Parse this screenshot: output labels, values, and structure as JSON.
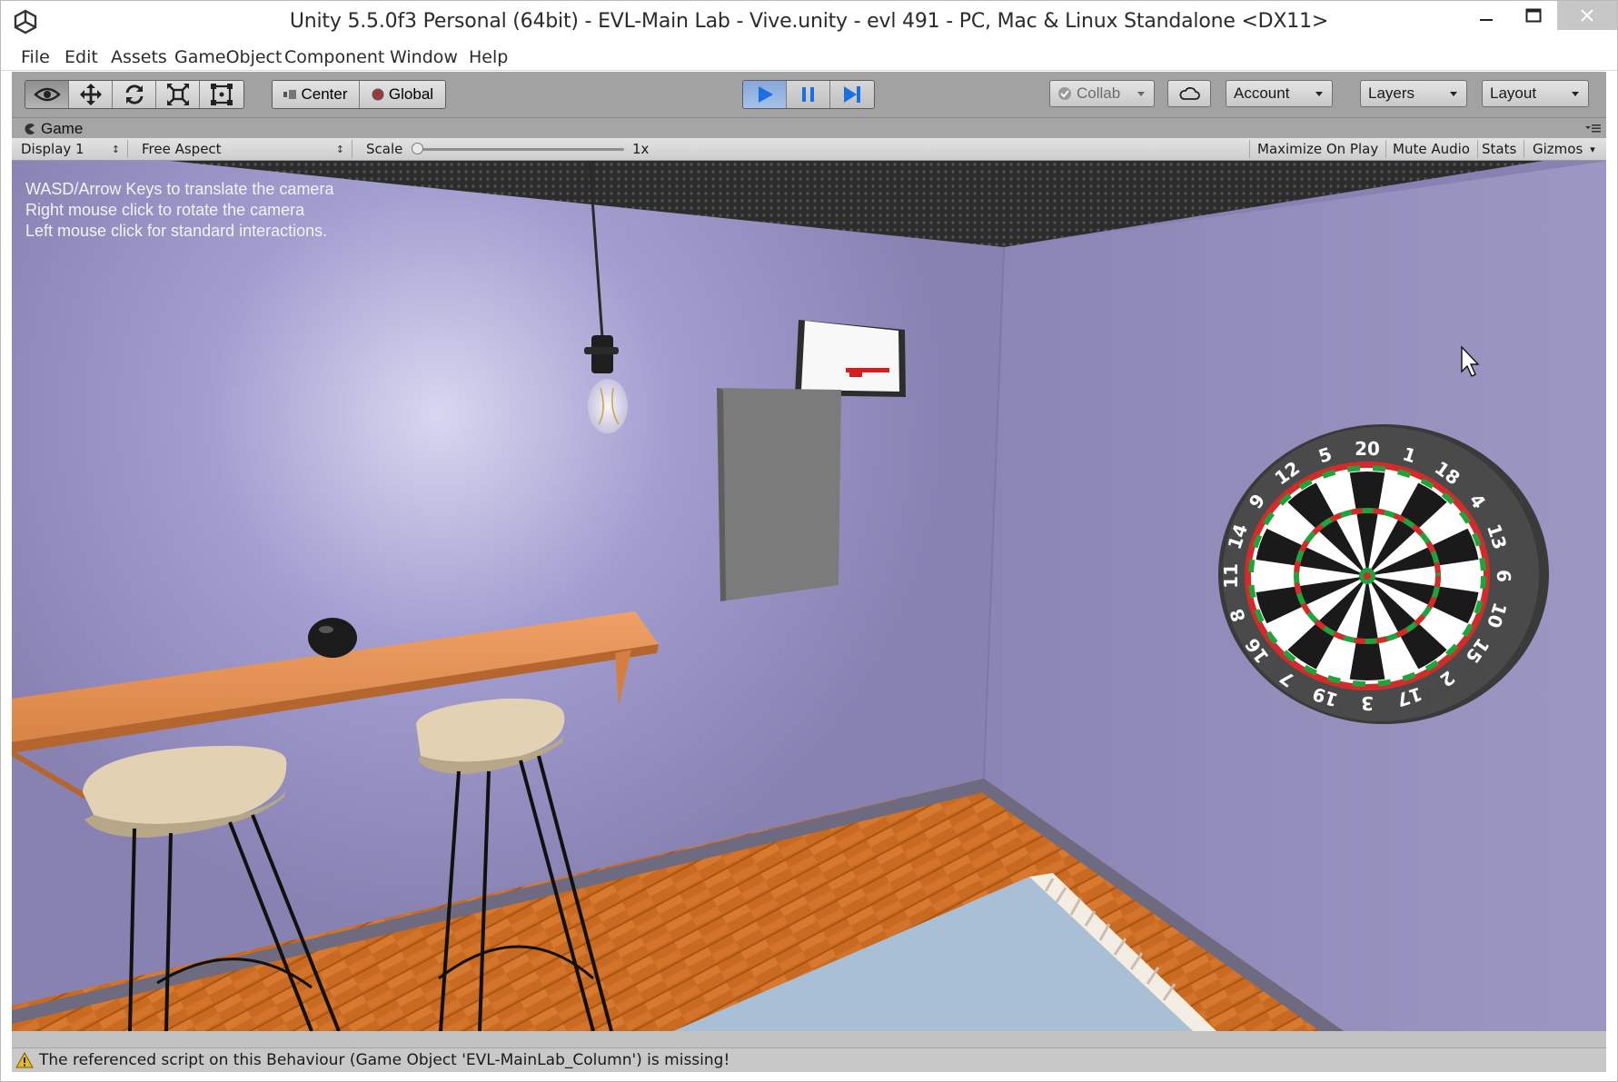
{
  "window": {
    "title": "Unity 5.5.0f3 Personal (64bit) - EVL-Main Lab - Vive.unity - evl 491 - PC, Mac & Linux Standalone <DX11>"
  },
  "menu": [
    "File",
    "Edit",
    "Assets",
    "GameObject",
    "Component",
    "Window",
    "Help"
  ],
  "toolbar": {
    "tools": [
      "view-tool",
      "move-tool",
      "rotate-tool",
      "scale-tool",
      "rect-tool"
    ],
    "pivot_label": "Center",
    "space_label": "Global",
    "collab_label": "Collab",
    "account_label": "Account",
    "layers_label": "Layers",
    "layout_label": "Layout"
  },
  "game": {
    "tab_label": "Game",
    "display_label": "Display 1",
    "aspect_label": "Free Aspect",
    "scale_label": "Scale",
    "scale_value": "1x",
    "maximize_label": "Maximize On Play",
    "mute_label": "Mute Audio",
    "stats_label": "Stats",
    "gizmos_label": "Gizmos",
    "hud_lines": [
      "WASD/Arrow Keys to translate the camera",
      "Right mouse click to rotate the camera",
      "Left mouse click for standard interactions."
    ],
    "dartboard_numbers": [
      "20",
      "1",
      "18",
      "4",
      "13",
      "6",
      "10",
      "15",
      "2",
      "17",
      "3",
      "19",
      "7",
      "16",
      "8",
      "11",
      "14",
      "9",
      "12",
      "5"
    ]
  },
  "status": {
    "message": "The referenced script on this Behaviour (Game Object 'EVL-MainLab_Column') is missing!"
  },
  "colors": {
    "play_accent": "#1b6fe0",
    "wall": "#8f89b6",
    "shelf": "#e28a4a",
    "floor": "#c7671e"
  }
}
